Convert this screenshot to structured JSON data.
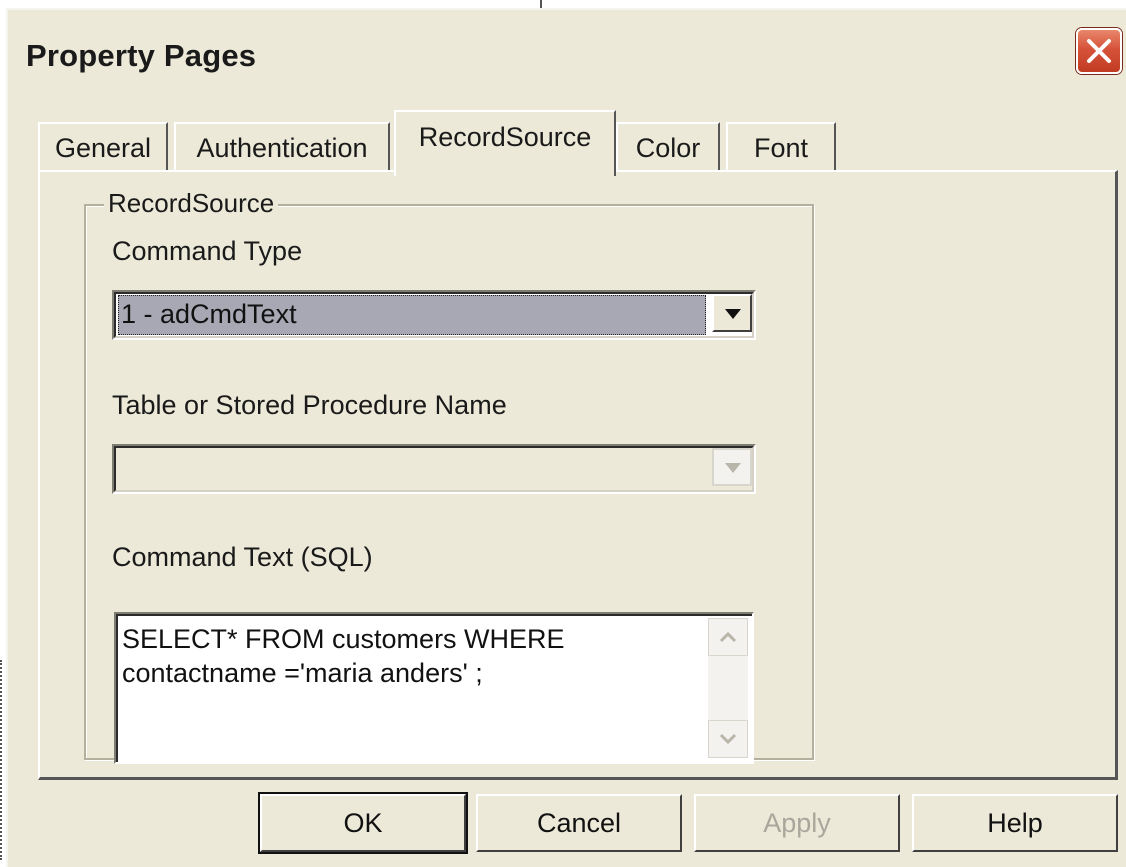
{
  "window": {
    "title": "Property Pages"
  },
  "tabs": [
    {
      "label": "General",
      "active": false
    },
    {
      "label": "Authentication",
      "active": false
    },
    {
      "label": "RecordSource",
      "active": true
    },
    {
      "label": "Color",
      "active": false
    },
    {
      "label": "Font",
      "active": false
    }
  ],
  "recordsource": {
    "group_label": "RecordSource",
    "command_type_label": "Command Type",
    "command_type_value": "1 - adCmdText",
    "table_label": "Table or Stored Procedure Name",
    "table_value": "",
    "command_text_label": "Command Text (SQL)",
    "command_text_value": "SELECT* FROM customers WHERE\ncontactname ='maria anders' ;"
  },
  "buttons": {
    "ok": "OK",
    "cancel": "Cancel",
    "apply": "Apply",
    "help": "Help"
  },
  "icons": {
    "close": "close-icon",
    "dropdown": "chevron-down-icon",
    "scroll_up": "chevron-up-icon",
    "scroll_down": "chevron-down-icon"
  },
  "colors": {
    "dialog_bg": "#ece9d8",
    "close_button": "#d6533a",
    "selection_bg": "#a8a8b4"
  }
}
